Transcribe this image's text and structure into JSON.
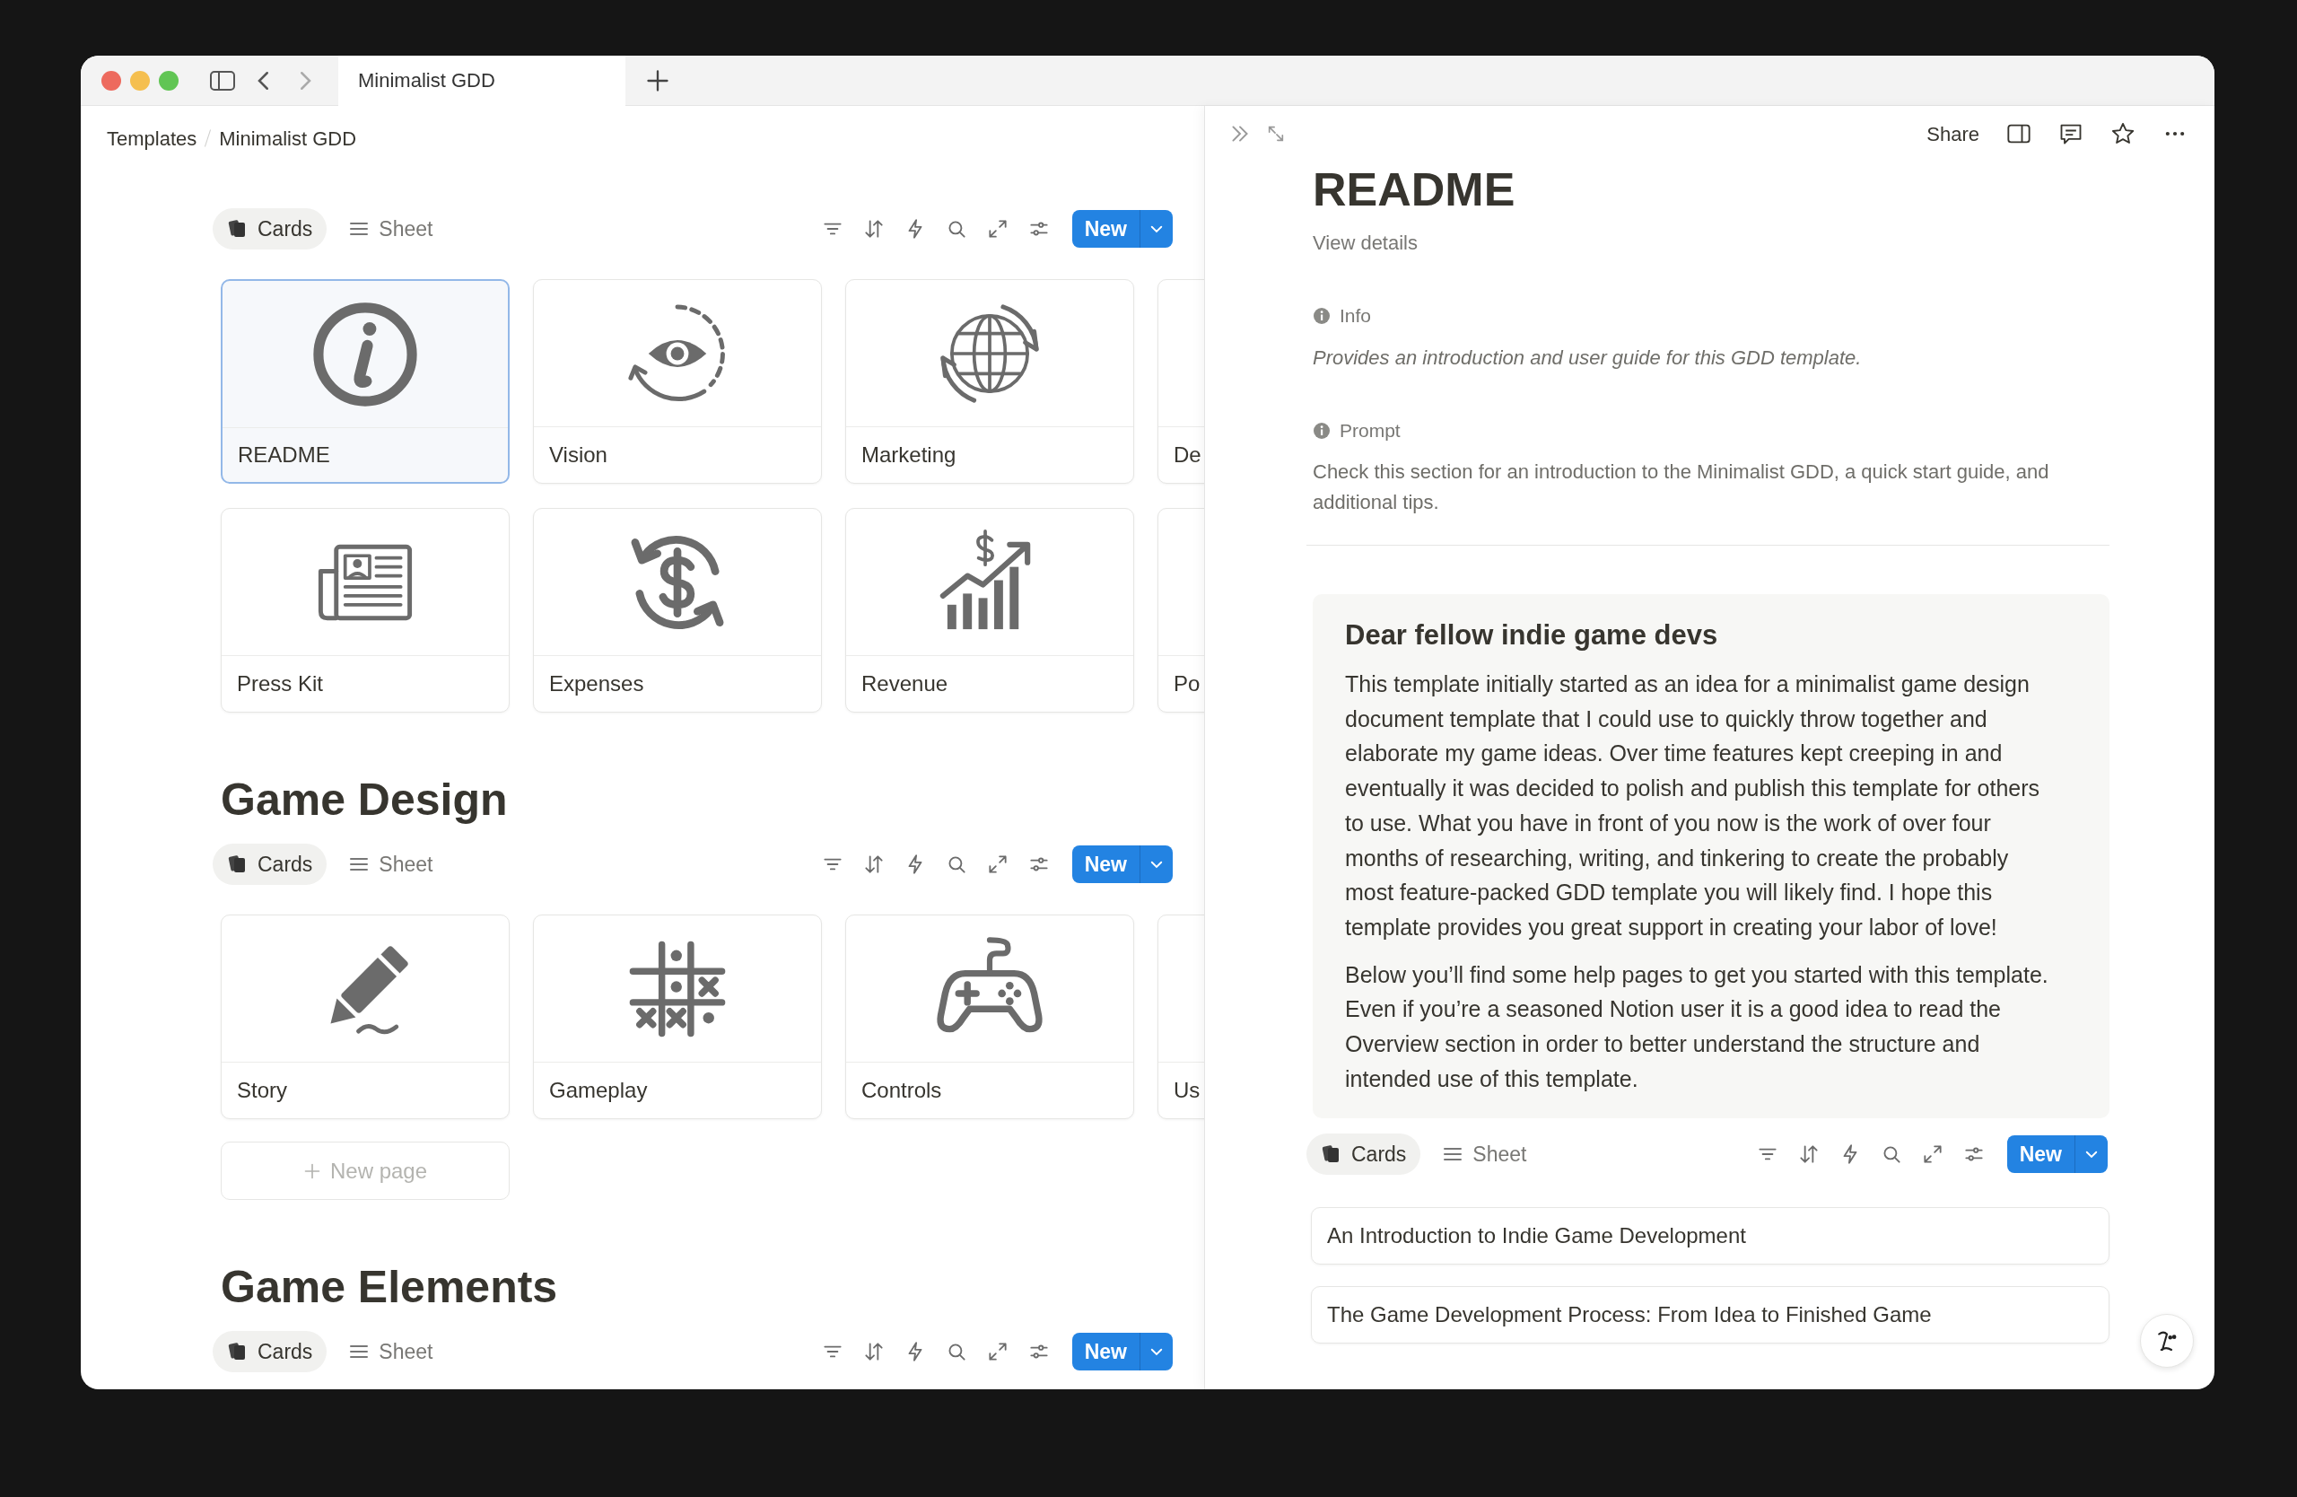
{
  "browser": {
    "tab_title": "Minimalist GDD"
  },
  "breadcrumb": [
    "Templates",
    "Minimalist GDD"
  ],
  "sections": [
    {
      "views": [
        {
          "label": "Cards",
          "selected": true
        },
        {
          "label": "Sheet",
          "selected": false
        }
      ],
      "new_button": "New",
      "cards": [
        {
          "title": "README",
          "selected": true
        },
        {
          "title": "Vision",
          "selected": false
        },
        {
          "title": "Marketing",
          "selected": false
        },
        {
          "title": "De",
          "selected": false
        },
        {
          "title": "Press Kit",
          "selected": false
        },
        {
          "title": "Expenses",
          "selected": false
        },
        {
          "title": "Revenue",
          "selected": false
        },
        {
          "title": "Po",
          "selected": false
        }
      ]
    },
    {
      "title": "Game Design",
      "views": [
        {
          "label": "Cards",
          "selected": true
        },
        {
          "label": "Sheet",
          "selected": false
        }
      ],
      "new_button": "New",
      "cards": [
        {
          "title": "Story",
          "selected": false
        },
        {
          "title": "Gameplay",
          "selected": false
        },
        {
          "title": "Controls",
          "selected": false
        },
        {
          "title": "Us",
          "selected": false
        }
      ],
      "new_page": "New page"
    },
    {
      "title": "Game Elements",
      "views": [
        {
          "label": "Cards",
          "selected": true
        },
        {
          "label": "Sheet",
          "selected": false
        }
      ],
      "new_button": "New"
    }
  ],
  "peek": {
    "share": "Share",
    "title": "README",
    "view_details": "View details",
    "properties": [
      {
        "label": "Info",
        "value": "Provides an introduction and user guide for this GDD template.",
        "italic": true
      },
      {
        "label": "Prompt",
        "value": "Check this section for an introduction to the Minimalist GDD, a quick start guide, and additional tips.",
        "italic": false
      }
    ],
    "callout": {
      "heading": "Dear fellow indie game devs",
      "paragraphs": [
        "This template initially started as an idea for a minimalist game design document template that I could use to quickly throw together and elaborate my game ideas. Over time features kept creeping in and eventually it was decided to polish and publish this template for others to use. What you have in front of you now is the work of over four months of researching, writing, and tinkering to create the probably most feature-packed GDD template you will likely find. I hope this template provides you great support in creating your labor of love!",
        "Below you’ll find some help pages to get you started with this template. Even if you’re a seasoned Notion user it is a good idea to read the Overview section in order to better understand the structure and intended use of this template."
      ]
    },
    "views": [
      {
        "label": "Cards",
        "selected": true
      },
      {
        "label": "Sheet",
        "selected": false
      }
    ],
    "new_button": "New",
    "pages": [
      "An Introduction to Indie Game Development",
      "The Game Development Process: From Idea to Finished Game"
    ]
  }
}
